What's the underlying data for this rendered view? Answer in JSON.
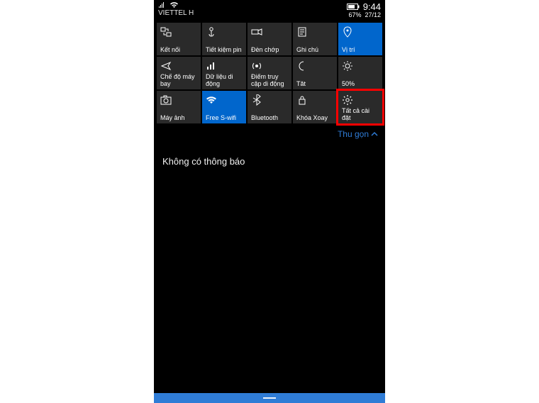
{
  "status": {
    "carrier": "VIETTEL H",
    "time": "9:44",
    "battery_pct": "67%",
    "date": "27/12"
  },
  "tiles": [
    {
      "id": "connect",
      "label": "Kết nối",
      "icon": "connect-icon"
    },
    {
      "id": "battery-save",
      "label": "Tiết kiệm pin",
      "icon": "leaf-icon"
    },
    {
      "id": "flashlight",
      "label": "Đèn chớp",
      "icon": "flashlight-icon"
    },
    {
      "id": "note",
      "label": "Ghi chú",
      "icon": "note-icon"
    },
    {
      "id": "location",
      "label": "Vị trí",
      "icon": "location-icon",
      "active": true
    },
    {
      "id": "airplane",
      "label": "Chế độ máy bay",
      "icon": "airplane-icon"
    },
    {
      "id": "cellular",
      "label": "Dữ liệu di động",
      "icon": "cellular-icon"
    },
    {
      "id": "hotspot",
      "label": "Điểm truy cập di động",
      "icon": "hotspot-icon"
    },
    {
      "id": "quiet",
      "label": "Tắt",
      "icon": "moon-icon"
    },
    {
      "id": "brightness",
      "label": "50%",
      "icon": "brightness-icon"
    },
    {
      "id": "camera",
      "label": "Máy ảnh",
      "icon": "camera-icon"
    },
    {
      "id": "wifi",
      "label": "Free S-wifi",
      "icon": "wifi-icon",
      "active": true
    },
    {
      "id": "bluetooth",
      "label": "Bluetooth",
      "icon": "bluetooth-icon"
    },
    {
      "id": "rotation",
      "label": "Khóa Xoay",
      "icon": "rotation-lock-icon"
    },
    {
      "id": "settings",
      "label": "Tất cả cài đặt",
      "icon": "gear-icon",
      "highlight": true
    }
  ],
  "collapse": {
    "label": "Thu gọn"
  },
  "notifications": {
    "empty_text": "Không có thông báo"
  }
}
